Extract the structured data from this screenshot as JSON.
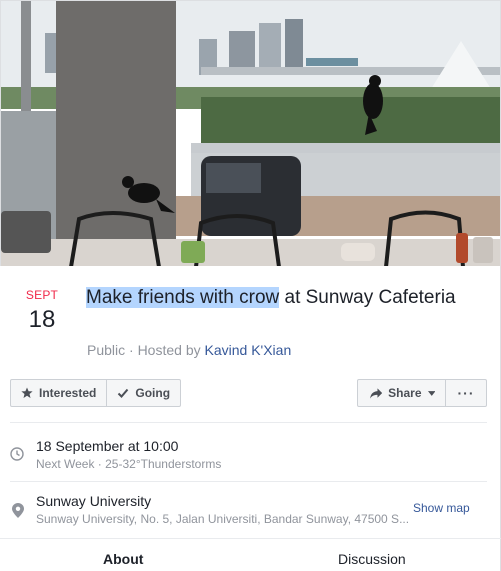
{
  "event": {
    "date": {
      "month": "SEPT",
      "day": "18"
    },
    "title_highlighted": "Make friends with crow",
    "title_rest": " at Sunway Cafeteria",
    "meta_prefix": "Public · Hosted by ",
    "host": "Kavind K'Xian"
  },
  "actions": {
    "interested": "Interested",
    "going": "Going",
    "share": "Share",
    "more": "···"
  },
  "details": {
    "time_primary": "18 September at 10:00",
    "time_secondary": "Next Week · 25-32°Thunderstorms",
    "location_primary": "Sunway University",
    "location_secondary": "Sunway University, No. 5, Jalan Universiti, Bandar Sunway, 47500 S...",
    "show_map": "Show map"
  },
  "tabs": {
    "about": "About",
    "discussion": "Discussion"
  },
  "colors": {
    "date_month": "#f02849",
    "link": "#365899",
    "highlight": "#b4d5fe"
  },
  "cover": {
    "description_icon": "cafeteria-crow-photo"
  }
}
